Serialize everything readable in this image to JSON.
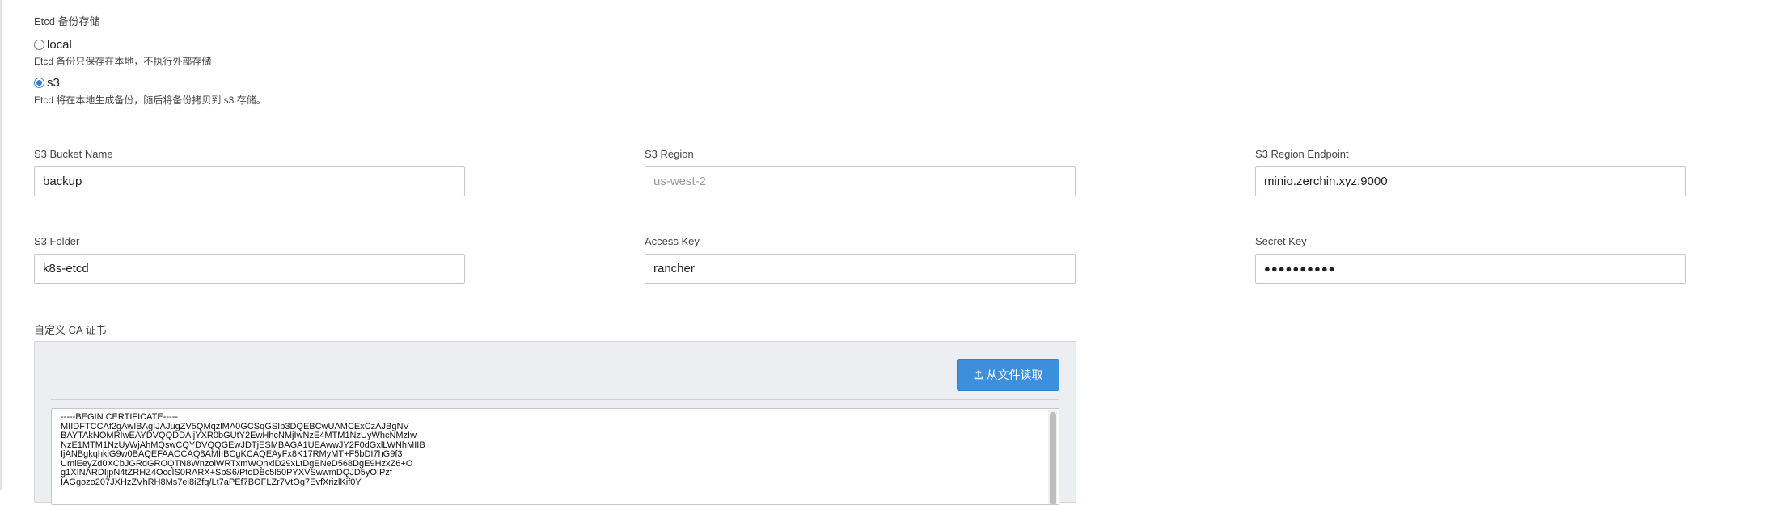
{
  "etcd": {
    "section_title": "Etcd 备份存储",
    "options": [
      {
        "label": "local",
        "checked": false,
        "help": "Etcd 备份只保存在本地，不执行外部存储"
      },
      {
        "label": "s3",
        "checked": true,
        "help": "Etcd 将在本地生成备份，随后将备份拷贝到 s3 存储。"
      }
    ]
  },
  "s3": {
    "bucket_name": {
      "label": "S3 Bucket Name",
      "value": "backup"
    },
    "region": {
      "label": "S3 Region",
      "value": "",
      "placeholder": "us-west-2"
    },
    "region_endpoint": {
      "label": "S3 Region Endpoint",
      "value": "minio.zerchin.xyz:9000"
    },
    "folder": {
      "label": "S3 Folder",
      "value": "k8s-etcd"
    },
    "access_key": {
      "label": "Access Key",
      "value": "rancher"
    },
    "secret_key": {
      "label": "Secret Key",
      "value": "●●●●●●●●●●"
    }
  },
  "ca": {
    "label": "自定义 CA 证书",
    "upload_label": "从文件读取",
    "content": "-----BEGIN CERTIFICATE-----\nMIIDFTCCAf2gAwIBAgIJAJugZV5QMqzlMA0GCSqGSIb3DQEBCwUAMCExCzAJBgNV\nBAYTAkNOMRIwEAYDVQQDDAljYXR0bGUtY2EwHhcNMjIwNzE4MTM1NzUyWhcNMzIw\nNzE1MTM1NzUyWjAhMQswCQYDVQQGEwJDTjESMBAGA1UEAwwJY2F0dGxlLWNhMIIB\nIjANBgkqhkiG9w0BAQEFAAOCAQ8AMIIBCgKCAQEAyFx8K17RMyMT+F5bDI7hG9f3\nUmlEeyZd0XCbJGRdGROQTN8WnzolWRTxmWQnxlD29xLtDgENeD568DgE9HzxZ6+O\ng1XINARDIjpN4tZRHZ4OccIS0RARX+SbS6/PtoDBc5l50PYXVSwwmDQJD5yOIPzf\nIAGgozo207JXHzZVhRH8Ms7ei8iZfq/Lt7aPEf7BOFLZr7VtOg7EvfXrizlKif0Y"
  }
}
